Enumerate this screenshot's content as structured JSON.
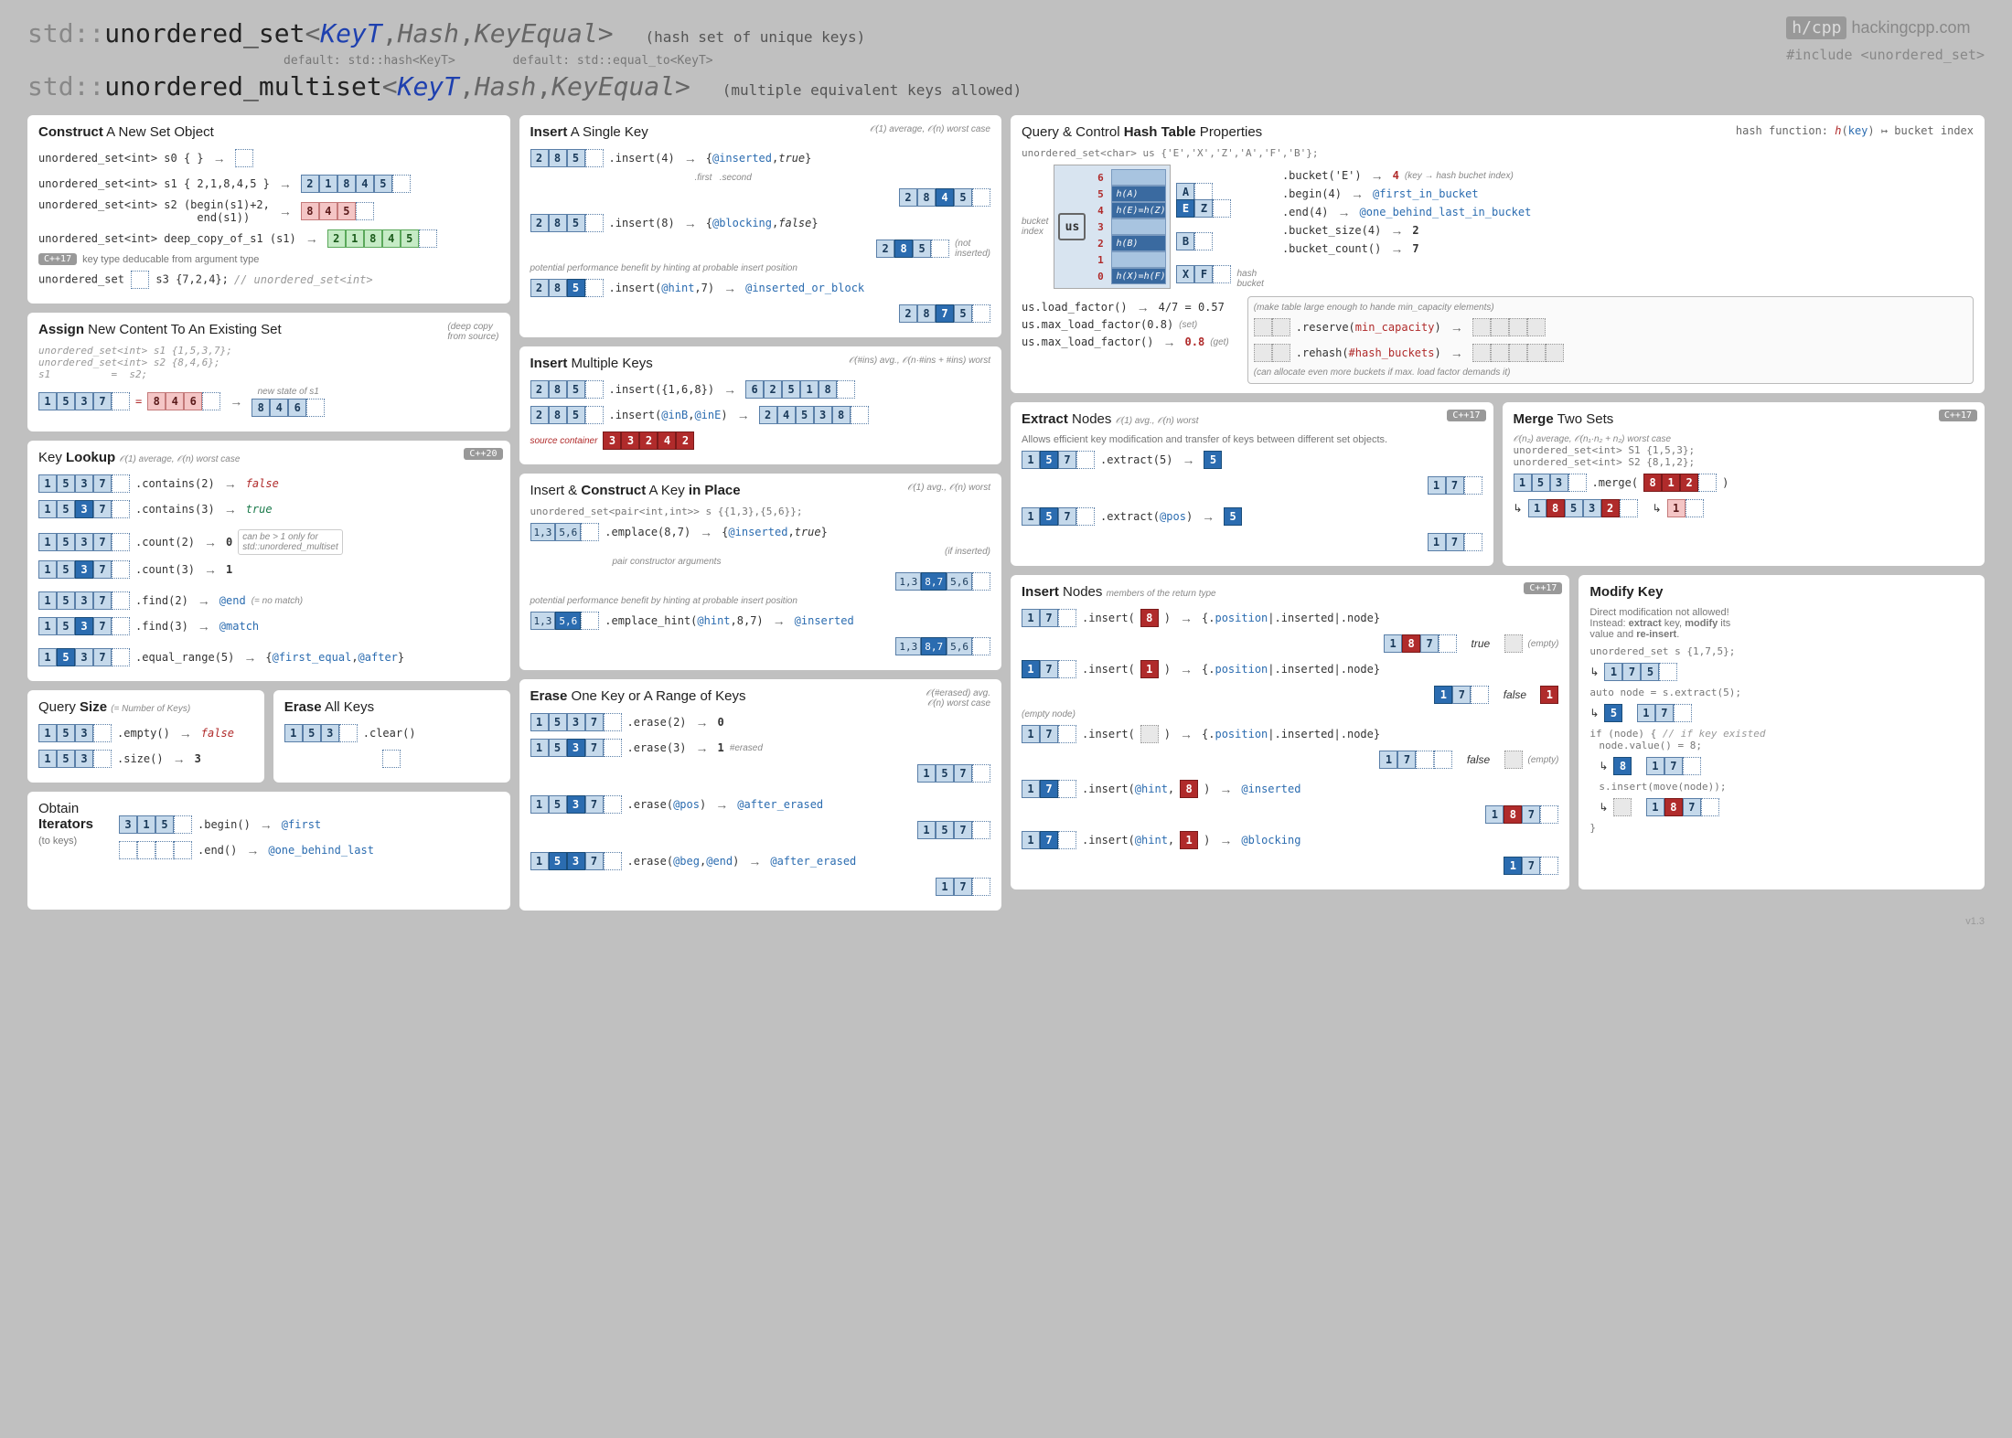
{
  "header": {
    "ns": "std::",
    "type1": "unordered_set",
    "type2": "unordered_multiset",
    "keyt": "KeyT",
    "hash": "Hash",
    "keyeq": "KeyEqual",
    "desc1": "(hash set of unique keys)",
    "desc2": "(multiple equivalent keys allowed)",
    "default_hash": "default:  std::hash<KeyT>",
    "default_eq": "default:  std::equal_to<KeyT>",
    "site": "hackingcpp.com",
    "logo": "h/cpp",
    "include": "#include <unordered_set>",
    "version": "v1.3"
  },
  "construct": {
    "title_pre": "Construct",
    "title_post": " A New Set Object",
    "l1": "unordered_set<int> s0 { }",
    "l2": "unordered_set<int> s1 { 2,1,8,4,5 }",
    "l2_cells": [
      "2",
      "1",
      "8",
      "4",
      "5"
    ],
    "l3": "unordered_set<int> s2 (begin(s1)+2,\n                        end(s1))",
    "l3_cells": [
      "8",
      "4",
      "5"
    ],
    "l4": "unordered_set<int> deep_copy_of_s1 (s1)",
    "l4_cells": [
      "2",
      "1",
      "8",
      "4",
      "5"
    ],
    "tag": "C++17",
    "note": "key type deducable from argument type",
    "l5_pre": "unordered_set",
    "l5_post": "s3 {7,2,4};",
    "l5_comment": "// unordered_set<int>"
  },
  "assign": {
    "title_pre": "Assign",
    "title_post": " New Content To An Existing Set",
    "note": "(deep copy\nfrom source)",
    "code": "unordered_set<int> s1 {1,5,3,7};\nunordered_set<int> s2 {8,4,6};\ns1          =  s2;",
    "before": [
      "1",
      "5",
      "3",
      "7"
    ],
    "src": [
      "8",
      "4",
      "6"
    ],
    "after_label": "new state of s1",
    "after": [
      "8",
      "4",
      "6"
    ]
  },
  "lookup": {
    "title_pre": "Key ",
    "title": "Lookup",
    "complexity": "𝒪(1) average, 𝒪(n) worst case",
    "tag": "C++20",
    "cells": [
      "1",
      "5",
      "3",
      "7"
    ],
    "contains2": ".contains(2)",
    "contains3": ".contains(3)",
    "count2": ".count(2)",
    "count3": ".count(3)",
    "count_note": "can be > 1 only for\nstd::unordered_multiset",
    "find2": ".find(2)",
    "find3": ".find(3)",
    "eqr": ".equal_range(5)",
    "end": "@end",
    "nomatch": "(= no match)",
    "match": "@match",
    "first_equal": "@first_equal",
    "after": "@after"
  },
  "size": {
    "title_pre": "Query ",
    "title": "Size",
    "note": "(= Number of Keys)",
    "cells": [
      "1",
      "5",
      "3"
    ],
    "empty": ".empty()",
    "size": ".size()",
    "size_val": "3"
  },
  "erase_all": {
    "title_pre": "Erase",
    "title_post": " All Keys",
    "cells": [
      "1",
      "5",
      "3"
    ],
    "clear": ".clear()"
  },
  "iterators": {
    "title_pre": "Obtain",
    "title": "Iterators",
    "note": "(to keys)",
    "cells": [
      "3",
      "1",
      "5"
    ],
    "begin": ".begin()",
    "end": ".end()",
    "first": "@first",
    "last": "@one_behind_last"
  },
  "insert1": {
    "title_pre": "Insert",
    "title_post": " A Single Key",
    "complexity": "𝒪(1) average, 𝒪(n) worst case",
    "cells": [
      "2",
      "8",
      "5"
    ],
    "ins4": ".insert(4)",
    "ins4_res": [
      "2",
      "8",
      "4",
      "5"
    ],
    "inserted": "@inserted",
    "first": ".first",
    "second": ".second",
    "ins8": ".insert(8)",
    "blocking": "@blocking",
    "notins": "(not\ninserted)",
    "hint_note": "potential performance benefit by hinting at probable insert position",
    "inshint": ".insert(@hint,7)",
    "inshint_res": [
      "2",
      "8",
      "7",
      "5"
    ],
    "ins_or_block": "@inserted_or_block"
  },
  "insertmulti": {
    "title_pre": "Insert",
    "title_post": " Multiple Keys",
    "complexity": "𝒪(#ins) avg., 𝒪(n·#ins + #ins) worst",
    "cells": [
      "2",
      "8",
      "5"
    ],
    "ins_list": ".insert({1,6,8})",
    "ins_list_res": [
      "6",
      "2",
      "5",
      "1",
      "8"
    ],
    "ins_range": ".insert(@inB,@inE)",
    "ins_range_res": [
      "2",
      "4",
      "5",
      "3",
      "8"
    ],
    "src_label": "source container",
    "src": [
      "3",
      "3",
      "2",
      "4",
      "2"
    ]
  },
  "emplace": {
    "title_pre": "Insert & ",
    "title_mid": "Construct",
    "title_post": " A Key ",
    "title_end": "in Place",
    "complexity": "𝒪(1) avg., 𝒪(n) worst",
    "decl": "unordered_set<pair<int,int>> s {{1,3},{5,6}};",
    "cells": [
      "1,3",
      "5,6"
    ],
    "emp": ".emplace(8,7)",
    "emp_res": [
      "1,3",
      "8,7",
      "5,6"
    ],
    "inserted": "@inserted",
    "ifins": "(if inserted)",
    "args_note": "pair constructor arguments",
    "hint_note": "potential performance benefit by hinting at probable insert position",
    "emphint": ".emplace_hint(@hint,8,7)"
  },
  "erase": {
    "title_pre": "Erase",
    "title_post": " One Key or A Range of Keys",
    "complexity": "𝒪(#erased) avg.\n𝒪(n) worst case",
    "cells": [
      "1",
      "5",
      "3",
      "7"
    ],
    "e2": ".erase(2)",
    "e3": ".erase(3)",
    "e3_res": [
      "1",
      "5",
      "7"
    ],
    "label": "#erased",
    "epos": ".erase(@pos)",
    "epos_res": [
      "1",
      "5",
      "7"
    ],
    "after_erased": "@after_erased",
    "erange": ".erase(@beg,@end)",
    "erange_res": [
      "1",
      "7"
    ]
  },
  "hashprops": {
    "title_pre": "Query & Control ",
    "title": "Hash Table",
    "title_post": " Properties",
    "hnote": "hash function:  h(key) ↦ bucket index",
    "decl": "unordered_set<char> us {'E','X','Z','A','F','B'};",
    "us": "us",
    "idx": [
      "6",
      "5",
      "4",
      "3",
      "2",
      "1",
      "0"
    ],
    "buckets": [
      "",
      "h(A)",
      "h(E)=h(Z)",
      "",
      "h(B)",
      "",
      "h(X)=h(F)"
    ],
    "bucket_active": [
      false,
      true,
      true,
      false,
      true,
      false,
      true
    ],
    "chain5": [
      "A"
    ],
    "chain4": [
      "E",
      "Z"
    ],
    "chain2": [
      "B"
    ],
    "chain0": [
      "X",
      "F"
    ],
    "label_bucket_idx": "bucket\nindex",
    "label_hash_bucket": "hash\nbucket",
    "bucket_e": ".bucket('E')",
    "bucket_e_res": "4",
    "bucket_e_note": "(key → hash buchet index)",
    "begin4": ".begin(4)",
    "first_in_bucket": "@first_in_bucket",
    "end4": ".end(4)",
    "behind_last_bucket": "@one_behind_last_in_bucket",
    "bsize": ".bucket_size(4)",
    "bsize_res": "2",
    "bcount": ".bucket_count()",
    "bcount_res": "7",
    "lf": "us.load_factor()",
    "lf_res": "4/7 = 0.57",
    "mlf_set": "us.max_load_factor(0.8)",
    "mlf_set_note": "(set)",
    "mlf_get": "us.max_load_factor()",
    "mlf_get_res": "0.8",
    "mlf_get_note": "(get)",
    "reserve_note": "(make table large enough to hande min_capacity elements)",
    "reserve": ".reserve(min_capacity)",
    "rehash": ".rehash(#hash_buckets)",
    "rehash_note": "(can allocate even more buckets if max. load factor demands it)"
  },
  "extract": {
    "title_pre": "Extract",
    "title_post": " Nodes",
    "complexity": "𝒪(1) avg., 𝒪(n) worst",
    "tag": "C++17",
    "note": "Allows efficient key modification and transfer of keys between different set objects.",
    "cells": [
      "1",
      "5",
      "7"
    ],
    "ext5": ".extract(5)",
    "ext5_res": "5",
    "after5": [
      "1",
      "7"
    ],
    "extpos": ".extract(@pos)",
    "extpos_res": "5",
    "afterpos": [
      "1",
      "7"
    ]
  },
  "merge": {
    "title_pre": "Merge",
    "title_post": " Two Sets",
    "tag": "C++17",
    "complexity": "𝒪(n₂) average, 𝒪(n₁·n₂ + n₂) worst case",
    "decl1": "unordered_set<int> S1 {1,5,3};",
    "decl2": "unordered_set<int> S2 {8,1,2};",
    "s1": [
      "1",
      "5",
      "3"
    ],
    "merge_call": ".merge(",
    "s2": [
      "8",
      "1",
      "2"
    ],
    "res_s1": [
      "1",
      "8",
      "5",
      "3",
      "2"
    ],
    "res_s2": [
      "1"
    ]
  },
  "insertnodes": {
    "title_pre": "Insert",
    "title_post": " Nodes",
    "tag": "C++17",
    "members_note": "members of the return type",
    "cells": [
      "1",
      "7"
    ],
    "ins8": ".insert(",
    "n8": "8",
    "ret": "{.position|.inserted|.node}",
    "res8": [
      "1",
      "8",
      "7"
    ],
    "ins1": ".insert(",
    "n1": "1",
    "res1": [
      "1",
      "7"
    ],
    "empty_note": "(empty node)",
    "insempty": ".insert(",
    "inshint8": ".insert(@hint,",
    "reshint8": [
      "1",
      "8",
      "7"
    ],
    "inserted": "@inserted",
    "inshint1": ".insert(@hint,",
    "reshint1": [
      "1",
      "7"
    ],
    "blocking": "@blocking",
    "empty": "(empty)"
  },
  "modify": {
    "title": "Modify Key",
    "note_pre": "Direct modification not allowed!\nInstead: ",
    "extract": "extract",
    "note_mid": " key, ",
    "modify": "modify",
    "note_post": " its\nvalue and ",
    "reinsert": "re-insert",
    "decl": "unordered_set s {1,7,5};",
    "cells0": [
      "1",
      "7",
      "5"
    ],
    "l_extract": "auto node = s.extract(5);",
    "node5": "5",
    "cells1": [
      "1",
      "7"
    ],
    "l_if": "if (node) {",
    "l_if_comment": "// if key existed",
    "l_val": "node.value() = 8;",
    "node8": "8",
    "l_ins": "s.insert(move(node));",
    "cells2": [
      "1",
      "8",
      "7"
    ],
    "l_end": "}"
  }
}
